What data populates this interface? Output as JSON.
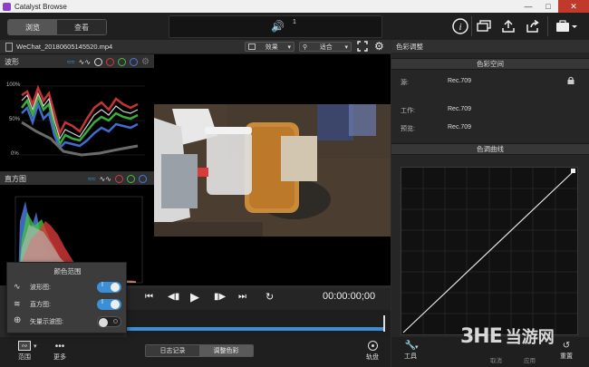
{
  "window": {
    "title": "Catalyst Browse"
  },
  "toolbar": {
    "mode_tabs": [
      "浏览",
      "查看"
    ],
    "audio_channel": "1"
  },
  "viewer": {
    "filename": "WeChat_20180605145520.mp4",
    "effects_label": "效果",
    "fit_label": "适合",
    "timecode": "00:00:00;00"
  },
  "scopes": {
    "waveform_title": "波形",
    "waveform_labels": [
      "100%",
      "50%",
      "0%"
    ],
    "histogram_title": "直方图"
  },
  "color_scope_popup": {
    "title": "颜色范围",
    "items": [
      {
        "label": "波形图:",
        "on": true
      },
      {
        "label": "直方图:",
        "on": true
      },
      {
        "label": "矢量示波图:",
        "on": false
      }
    ]
  },
  "bottom": {
    "scope_label": "范围",
    "more_label": "更多",
    "log_tab": "日志记录",
    "color_tab": "调整色彩",
    "disc_label": "轨盘"
  },
  "color_panel": {
    "title": "色彩调整",
    "space_header": "色彩空间",
    "source_label": "源:",
    "source_value": "Rec.709",
    "work_label": "工作:",
    "work_value": "Rec.709",
    "preview_label": "预览:",
    "preview_value": "Rec.709",
    "curve_header": "色调曲线",
    "tools_label": "工具",
    "cancel_label": "取消",
    "apply_label": "应用",
    "reset_label": "重置"
  },
  "watermark": {
    "brand": "3HE",
    "text": "当游网"
  },
  "colors": {
    "accent": "#3a8fd6",
    "red": "#d93a3a",
    "green": "#43c043",
    "blue": "#4a78e0"
  }
}
